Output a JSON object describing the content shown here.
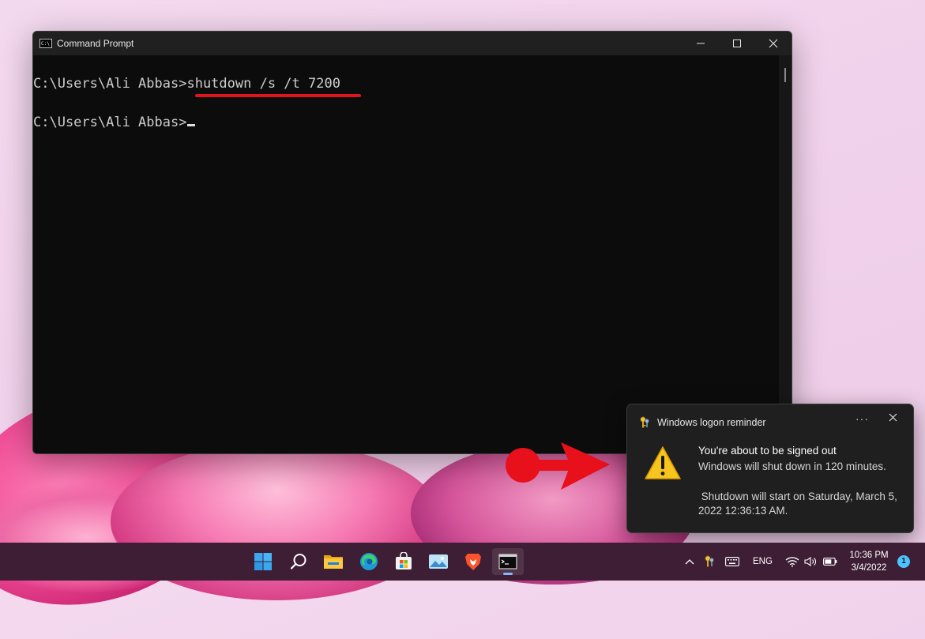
{
  "window": {
    "title": "Command Prompt",
    "icon": "cmd-icon",
    "icon_text": "C:\\",
    "controls": {
      "minimize": "─",
      "maximize": "☐",
      "close": "✕"
    }
  },
  "console": {
    "prompt1": "C:\\Users\\Ali Abbas>",
    "command1": "shutdown /s /t 7200",
    "prompt2": "C:\\Users\\Ali Abbas>"
  },
  "annotation": {
    "underline_color": "#e0141c",
    "arrow_color": "#e8101a"
  },
  "notification": {
    "app_name": "Windows logon reminder",
    "more": "···",
    "close": "✕",
    "title": "You're about to be signed out",
    "body": "Windows will shut down in 120 minutes.",
    "detail": " Shutdown will start on Saturday, March 5, 2022 12:36:13 AM."
  },
  "taskbar": {
    "apps": [
      "windows-start-icon",
      "search-icon",
      "file-explorer-icon",
      "edge-icon",
      "store-icon",
      "photos-icon",
      "brave-icon",
      "terminal-icon"
    ],
    "tray": {
      "chevron": "^",
      "language": "ENG",
      "time": "10:36 PM",
      "date": "3/4/2022",
      "notification_count": "1"
    }
  }
}
